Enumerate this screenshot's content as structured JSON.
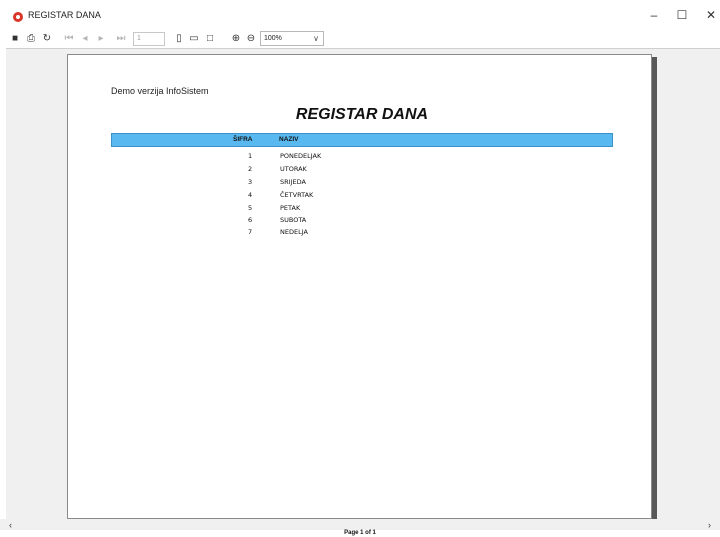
{
  "window": {
    "title": "REGISTAR DANA",
    "minimize": "–",
    "maximize": "☐",
    "close": "✕"
  },
  "toolbar": {
    "icons": [
      {
        "name": "save-icon",
        "glyph": "■"
      },
      {
        "name": "print-icon",
        "glyph": "⎙"
      },
      {
        "name": "refresh-icon",
        "glyph": "↻"
      },
      {
        "name": "first-page-icon",
        "glyph": "⏮"
      },
      {
        "name": "prev-page-icon",
        "glyph": "◂"
      },
      {
        "name": "next-page-icon",
        "glyph": "▸"
      },
      {
        "name": "last-page-icon",
        "glyph": "⏭"
      },
      {
        "name": "single-page-icon",
        "glyph": "▯"
      },
      {
        "name": "page-width-icon",
        "glyph": "▭"
      },
      {
        "name": "whole-page-icon",
        "glyph": "□"
      },
      {
        "name": "zoom-in-icon",
        "glyph": "⊕"
      },
      {
        "name": "zoom-out-icon",
        "glyph": "⊖"
      }
    ],
    "page_number": "1",
    "zoom": "100%",
    "zoom_caret": "∨"
  },
  "report": {
    "demo_text": "Demo verzija InfoSistem",
    "title": "REGISTAR DANA",
    "columns": {
      "sifra": "ŠIFRA",
      "naziv": "NAZIV"
    },
    "rows": [
      {
        "sifra": "1",
        "naziv": "PONEDELJAK"
      },
      {
        "sifra": "2",
        "naziv": "UTORAK"
      },
      {
        "sifra": "3",
        "naziv": "SRIJEDA"
      },
      {
        "sifra": "4",
        "naziv": "ČETVRTAK"
      },
      {
        "sifra": "5",
        "naziv": "PETAK"
      },
      {
        "sifra": "6",
        "naziv": "SUBOTA"
      },
      {
        "sifra": "7",
        "naziv": "NEDELJA"
      }
    ]
  },
  "scroll": {
    "left": "‹",
    "right": "›"
  },
  "status": {
    "page_info": "Page 1 of 1"
  },
  "colors": {
    "header_bar": "#5ab8f0",
    "app_icon": "#d9352a"
  }
}
